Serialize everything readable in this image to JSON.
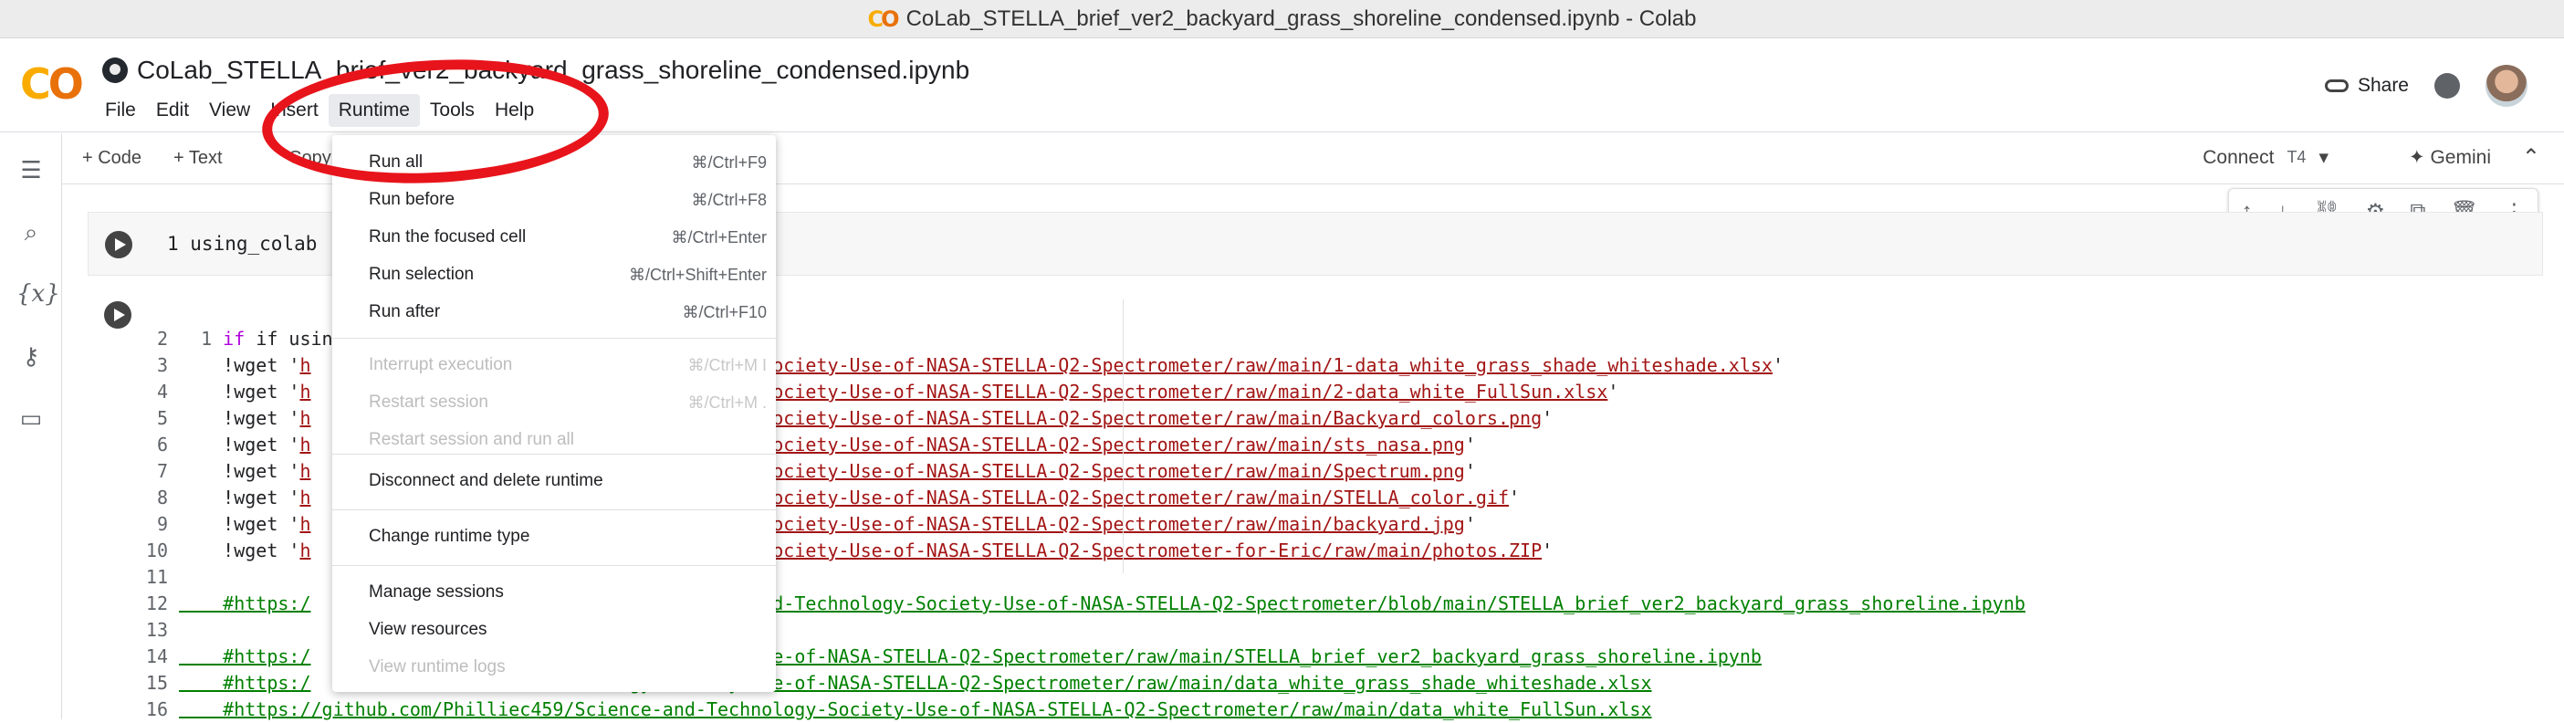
{
  "window": {
    "title": "CoLab_STELLA_brief_ver2_backyard_grass_shoreline_condensed.ipynb - Colab"
  },
  "header": {
    "notebook_name": "CoLab_STELLA_brief_ver2_backyard_grass_shoreline_condensed.ipynb",
    "menu": [
      "File",
      "Edit",
      "View",
      "Insert",
      "Runtime",
      "Tools",
      "Help"
    ],
    "share_label": "Share"
  },
  "toolbar": {
    "add_code": "+ Code",
    "add_text": "+ Text",
    "copy_partial": "Copy",
    "connect_label": "Connect",
    "runtime_type": "T4",
    "gemini_label": "Gemini"
  },
  "cells": {
    "cell1_code": "1 using_colab",
    "cell2_first": "if using_col"
  },
  "code_lines": [
    {
      "n": "1",
      "text": ""
    },
    {
      "n": "2",
      "text": ""
    },
    {
      "n": "3",
      "pre": "    !wget '",
      "cont": "h",
      "url": "and-Technology-Society-Use-of-NASA-STELLA-Q2-Spectrometer/raw/main/1-data_white_grass_shade_whiteshade.xlsx",
      "end": "'"
    },
    {
      "n": "4",
      "pre": "    !wget '",
      "cont": "h",
      "url": "and-Technology-Society-Use-of-NASA-STELLA-Q2-Spectrometer/raw/main/2-data_white_FullSun.xlsx",
      "end": "'"
    },
    {
      "n": "5",
      "pre": "    !wget '",
      "cont": "h",
      "url": "and-Technology-Society-Use-of-NASA-STELLA-Q2-Spectrometer/raw/main/Backyard_colors.png",
      "end": "'"
    },
    {
      "n": "6",
      "pre": "    !wget '",
      "cont": "h",
      "url": "and-Technology-Society-Use-of-NASA-STELLA-Q2-Spectrometer/raw/main/sts_nasa.png",
      "end": "'"
    },
    {
      "n": "7",
      "pre": "    !wget '",
      "cont": "h",
      "url": "and-Technology-Society-Use-of-NASA-STELLA-Q2-Spectrometer/raw/main/Spectrum.png",
      "end": "'"
    },
    {
      "n": "8",
      "pre": "    !wget '",
      "cont": "h",
      "url": "and-Technology-Society-Use-of-NASA-STELLA-Q2-Spectrometer/raw/main/STELLA_color.gif",
      "end": "'"
    },
    {
      "n": "9",
      "pre": "    !wget '",
      "cont": "h",
      "url": "and-Technology-Society-Use-of-NASA-STELLA-Q2-Spectrometer/raw/main/backyard.jpg",
      "end": "'"
    },
    {
      "n": "10",
      "pre": "    !wget '",
      "cont": "h",
      "url": "and-Technology-Society-Use-of-NASA-STELLA-Q2-Spectrometer-for-Eric/raw/main/photos.ZIP",
      "end": "'"
    },
    {
      "n": "11",
      "text": ""
    },
    {
      "n": "12",
      "cmt_a": "    #https:/",
      "cmt_b": "lliec459/Science-and-Technology-Society-Use-of-NASA-STELLA-Q2-Spectrometer/blob/main/STELLA_brief_ver2_backyard_grass_shoreline.ipynb"
    },
    {
      "n": "13",
      "text": ""
    },
    {
      "n": "14",
      "cmt_a": "    #https:/",
      "cmt_b": "chnology-Society-Use-of-NASA-STELLA-Q2-Spectrometer/raw/main/STELLA_brief_ver2_backyard_grass_shoreline.ipynb"
    },
    {
      "n": "15",
      "cmt_a": "    #https:/",
      "cmt_b": "chnology-Society-Use-of-NASA-STELLA-Q2-Spectrometer/raw/main/data_white_grass_shade_whiteshade.xlsx"
    },
    {
      "n": "16",
      "cmt_a": "    #https://github.com/Philliec459/Science-and-Technology-Society-Use-of-NASA-STELLA-Q2-Spectrometer/raw/main/data_white_FullSun.xlsx",
      "cmt_b": ""
    }
  ],
  "runtime_menu": {
    "items": [
      {
        "label": "Run all",
        "shortcut": "⌘/Ctrl+F9",
        "disabled": false
      },
      {
        "label": "Run before",
        "shortcut": "⌘/Ctrl+F8",
        "disabled": false
      },
      {
        "label": "Run the focused cell",
        "shortcut": "⌘/Ctrl+Enter",
        "disabled": false
      },
      {
        "label": "Run selection",
        "shortcut": "⌘/Ctrl+Shift+Enter",
        "disabled": false
      },
      {
        "label": "Run after",
        "shortcut": "⌘/Ctrl+F10",
        "disabled": false
      },
      {
        "label": "Interrupt execution",
        "shortcut": "⌘/Ctrl+M I",
        "disabled": true
      },
      {
        "label": "Restart session",
        "shortcut": "⌘/Ctrl+M .",
        "disabled": true
      },
      {
        "label": "Restart session and run all",
        "shortcut": "",
        "disabled": true
      },
      {
        "label": "Disconnect and delete runtime",
        "shortcut": "",
        "disabled": false
      },
      {
        "label": "Change runtime type",
        "shortcut": "",
        "disabled": false
      },
      {
        "label": "Manage sessions",
        "shortcut": "",
        "disabled": false
      },
      {
        "label": "View resources",
        "shortcut": "",
        "disabled": false
      },
      {
        "label": "View runtime logs",
        "shortcut": "",
        "disabled": true
      }
    ]
  },
  "colors": {
    "annotation": "#e8141b",
    "colab_orange": "#f9ab00",
    "string": "#a31515",
    "comment": "#008000",
    "keyword": "#af00db"
  }
}
